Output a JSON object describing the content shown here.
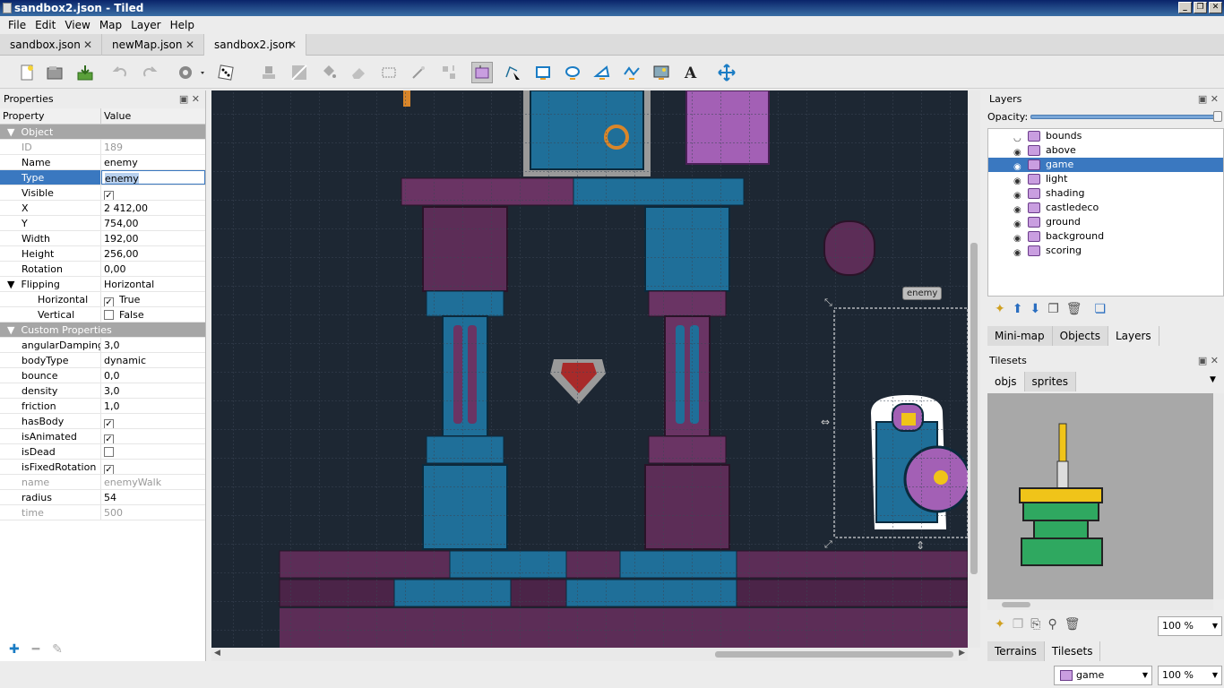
{
  "window": {
    "title": "sandbox2.json - Tiled"
  },
  "menu": [
    "File",
    "Edit",
    "View",
    "Map",
    "Layer",
    "Help"
  ],
  "tabs": [
    {
      "label": "sandbox.json"
    },
    {
      "label": "newMap.json"
    },
    {
      "label": "sandbox2.json"
    }
  ],
  "properties": {
    "title": "Properties",
    "col_property": "Property",
    "col_value": "Value",
    "object_group": "Object",
    "id_label": "ID",
    "id_value": "189",
    "name_label": "Name",
    "name_value": "enemy",
    "type_label": "Type",
    "type_value": "enemy",
    "visible_label": "Visible",
    "x_label": "X",
    "x_value": "2 412,00",
    "y_label": "Y",
    "y_value": "754,00",
    "width_label": "Width",
    "width_value": "192,00",
    "height_label": "Height",
    "height_value": "256,00",
    "rotation_label": "Rotation",
    "rotation_value": "0,00",
    "flipping_label": "Flipping",
    "flipping_value": "Horizontal",
    "horizontal_label": "Horizontal",
    "horizontal_value": "True",
    "vertical_label": "Vertical",
    "vertical_value": "False",
    "custom_group": "Custom Properties",
    "custom": [
      {
        "k": "angularDamping",
        "v": "3,0"
      },
      {
        "k": "bodyType",
        "v": "dynamic"
      },
      {
        "k": "bounce",
        "v": "0,0"
      },
      {
        "k": "density",
        "v": "3,0"
      },
      {
        "k": "friction",
        "v": "1,0"
      }
    ],
    "hasBody_label": "hasBody",
    "isAnimated_label": "isAnimated",
    "isDead_label": "isDead",
    "isFixedRotation_label": "isFixedRotation",
    "name2_label": "name",
    "name2_value": "enemyWalk",
    "radius_label": "radius",
    "radius_value": "54",
    "time_label": "time",
    "time_value": "500"
  },
  "map": {
    "object_label": "enemy"
  },
  "layers": {
    "title": "Layers",
    "opacity_label": "Opacity:",
    "opacity": 1.0,
    "items": [
      {
        "label": "bounds"
      },
      {
        "label": "above"
      },
      {
        "label": "game"
      },
      {
        "label": "light"
      },
      {
        "label": "shading"
      },
      {
        "label": "castledeco"
      },
      {
        "label": "ground"
      },
      {
        "label": "background"
      },
      {
        "label": "scoring"
      }
    ],
    "tabs": [
      "Mini-map",
      "Objects",
      "Layers"
    ]
  },
  "tilesets": {
    "title": "Tilesets",
    "tabs": [
      "objs",
      "sprites"
    ],
    "zoom": "100 %",
    "bottom_tabs": [
      "Terrains",
      "Tilesets"
    ]
  },
  "status": {
    "layer": "game",
    "zoom": "100 %"
  },
  "colors": {
    "selection": "#3a78c0",
    "map_bg": "#1d2733",
    "purple": "#6d3a6e",
    "blue": "#1f6f99"
  }
}
